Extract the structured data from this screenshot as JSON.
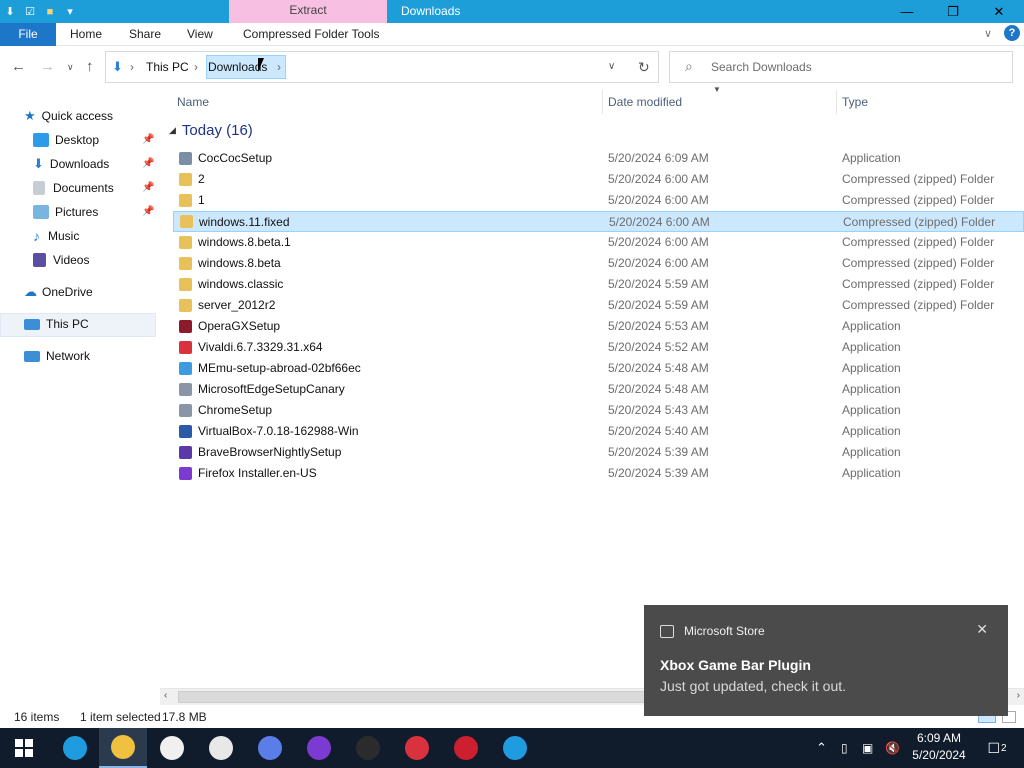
{
  "titlebar": {
    "context_tab": "Extract",
    "title": "Downloads",
    "minimize_icon": "minimize-icon",
    "maximize_icon": "restore-icon",
    "close_icon": "close-icon"
  },
  "ribbon": {
    "tabs": [
      "File",
      "Home",
      "Share",
      "View",
      "Compressed Folder Tools"
    ],
    "help": "?"
  },
  "nav": {
    "breadcrumb_root": "This PC",
    "breadcrumb_current": "Downloads",
    "search_placeholder": "Search Downloads"
  },
  "sidebar": {
    "items": [
      {
        "label": "Quick access",
        "color": "#1e76c9"
      },
      {
        "label": "Desktop",
        "color": "#2d9be8"
      },
      {
        "label": "Downloads",
        "color": "#2b7fd6"
      },
      {
        "label": "Documents",
        "color": "#9aa3ad"
      },
      {
        "label": "Pictures",
        "color": "#7ab5e0"
      },
      {
        "label": "Music",
        "color": "#2b7fd6"
      },
      {
        "label": "Videos",
        "color": "#5a4fa0"
      },
      {
        "label": "OneDrive",
        "color": "#1e76c9"
      },
      {
        "label": "This PC",
        "color": "#3a8fd6"
      },
      {
        "label": "Network",
        "color": "#3a8fd6"
      }
    ]
  },
  "columns": {
    "name": "Name",
    "date": "Date modified",
    "type": "Type"
  },
  "group": {
    "label": "Today (16)"
  },
  "files": [
    {
      "name": "CocCocSetup",
      "date": "5/20/2024 6:09 AM",
      "type": "Application",
      "color": "#7a8ea6"
    },
    {
      "name": "2",
      "date": "5/20/2024 6:00 AM",
      "type": "Compressed (zipped) Folder",
      "color": "#e8c15a"
    },
    {
      "name": "1",
      "date": "5/20/2024 6:00 AM",
      "type": "Compressed (zipped) Folder",
      "color": "#e8c15a"
    },
    {
      "name": "windows.11.fixed",
      "date": "5/20/2024 6:00 AM",
      "type": "Compressed (zipped) Folder",
      "color": "#e8c15a",
      "selected": true
    },
    {
      "name": "windows.8.beta.1",
      "date": "5/20/2024 6:00 AM",
      "type": "Compressed (zipped) Folder",
      "color": "#e8c15a"
    },
    {
      "name": "windows.8.beta",
      "date": "5/20/2024 6:00 AM",
      "type": "Compressed (zipped) Folder",
      "color": "#e8c15a"
    },
    {
      "name": "windows.classic",
      "date": "5/20/2024 5:59 AM",
      "type": "Compressed (zipped) Folder",
      "color": "#e8c15a"
    },
    {
      "name": "server_2012r2",
      "date": "5/20/2024 5:59 AM",
      "type": "Compressed (zipped) Folder",
      "color": "#e8c15a"
    },
    {
      "name": "OperaGXSetup",
      "date": "5/20/2024 5:53 AM",
      "type": "Application",
      "color": "#8b1a2a"
    },
    {
      "name": "Vivaldi.6.7.3329.31.x64",
      "date": "5/20/2024 5:52 AM",
      "type": "Application",
      "color": "#d9323f"
    },
    {
      "name": "MEmu-setup-abroad-02bf66ec",
      "date": "5/20/2024 5:48 AM",
      "type": "Application",
      "color": "#3d9be0"
    },
    {
      "name": "MicrosoftEdgeSetupCanary",
      "date": "5/20/2024 5:48 AM",
      "type": "Application",
      "color": "#8a96a6"
    },
    {
      "name": "ChromeSetup",
      "date": "5/20/2024 5:43 AM",
      "type": "Application",
      "color": "#8a96a6"
    },
    {
      "name": "VirtualBox-7.0.18-162988-Win",
      "date": "5/20/2024 5:40 AM",
      "type": "Application",
      "color": "#2a5aa8"
    },
    {
      "name": "BraveBrowserNightlySetup",
      "date": "5/20/2024 5:39 AM",
      "type": "Application",
      "color": "#5b3aa8"
    },
    {
      "name": "Firefox Installer.en-US",
      "date": "5/20/2024 5:39 AM",
      "type": "Application",
      "color": "#7b3ad0"
    }
  ],
  "status": {
    "count": "16 items",
    "selection": "1 item selected",
    "size": "17.8 MB"
  },
  "toast": {
    "app": "Microsoft Store",
    "title": "Xbox Game Bar Plugin",
    "message": "Just got updated, check it out."
  },
  "taskbar": {
    "apps": [
      {
        "name": "edge-icon",
        "color": "#1f9be0"
      },
      {
        "name": "file-explorer-icon",
        "color": "#f0c040",
        "active": true
      },
      {
        "name": "microsoft-store-icon",
        "color": "#f0f0f0"
      },
      {
        "name": "mail-icon",
        "color": "#e8e8e8"
      },
      {
        "name": "firefox-icon",
        "color": "#5a7de8"
      },
      {
        "name": "brave-icon",
        "color": "#7b3ad0"
      },
      {
        "name": "terminal-icon",
        "color": "#2b2b2b"
      },
      {
        "name": "vivaldi-icon",
        "color": "#d9323f"
      },
      {
        "name": "opera-icon",
        "color": "#cc1f2f"
      },
      {
        "name": "edge-canary-icon",
        "color": "#1f9be0"
      }
    ],
    "time": "6:09 AM",
    "date": "5/20/2024",
    "notifications": "2"
  }
}
